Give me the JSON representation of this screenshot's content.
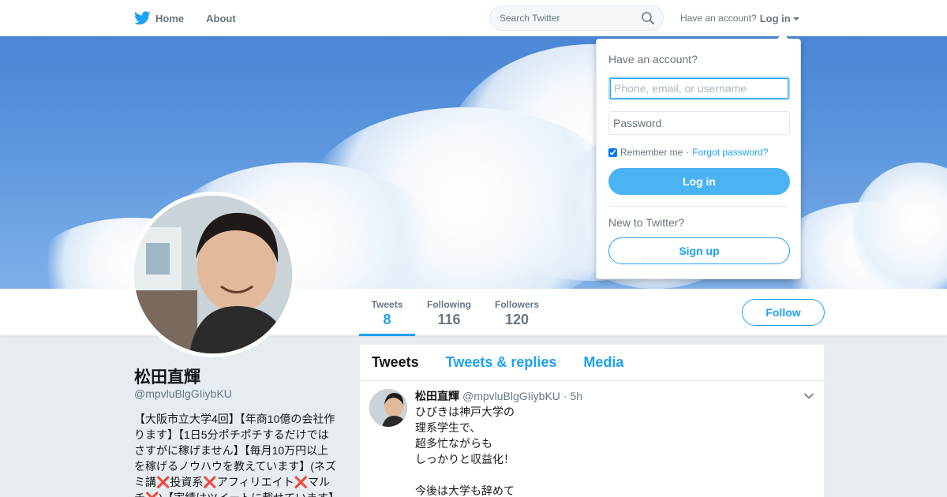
{
  "nav": {
    "home_label": "Home",
    "about_label": "About",
    "search_placeholder": "Search Twitter",
    "have_account": "Have an account?",
    "login_label": "Log in"
  },
  "profile": {
    "name": "松田直輝",
    "handle": "@mpvluBlgGIiybKU",
    "bio": "【大阪市立大学4回】【年商10億の会社作ります】【1日5分ポチポチするだけではさすがに稼げません】【毎月10万円以上を稼げるノウハウを教えています】(ネズミ講❌投資系❌アフィリエイト❌マルチ❌)【実績はツイートに載せています】"
  },
  "stats": [
    {
      "label": "Tweets",
      "value": "8"
    },
    {
      "label": "Following",
      "value": "116"
    },
    {
      "label": "Followers",
      "value": "120"
    }
  ],
  "follow_label": "Follow",
  "timeline": {
    "tabs": [
      "Tweets",
      "Tweets & replies",
      "Media"
    ],
    "tweet": {
      "name": "松田直輝",
      "handle": "@mpvluBlgGIiybKU",
      "time": "· 5h",
      "text": "ひびきは神戸大学の\n理系学生で、\n超多忙ながらも\nしっかりと収益化！\n\n今後は大学も辞めて"
    }
  },
  "login_dropdown": {
    "title": "Have an account?",
    "username_placeholder": "Phone, email, or username",
    "password_placeholder": "Password",
    "remember_label": "Remember me",
    "separator": "·",
    "forgot_label": "Forgot password?",
    "login_button": "Log in",
    "new_label": "New to Twitter?",
    "signup_button": "Sign up"
  },
  "colors": {
    "brand": "#1da1f2",
    "login_button": "#4ab3f4",
    "background": "#e6ecf0"
  },
  "icons": {
    "logo": "twitter-bird-icon",
    "search": "search-icon",
    "caret": "caret-down-icon",
    "more": "chevron-down-icon"
  }
}
